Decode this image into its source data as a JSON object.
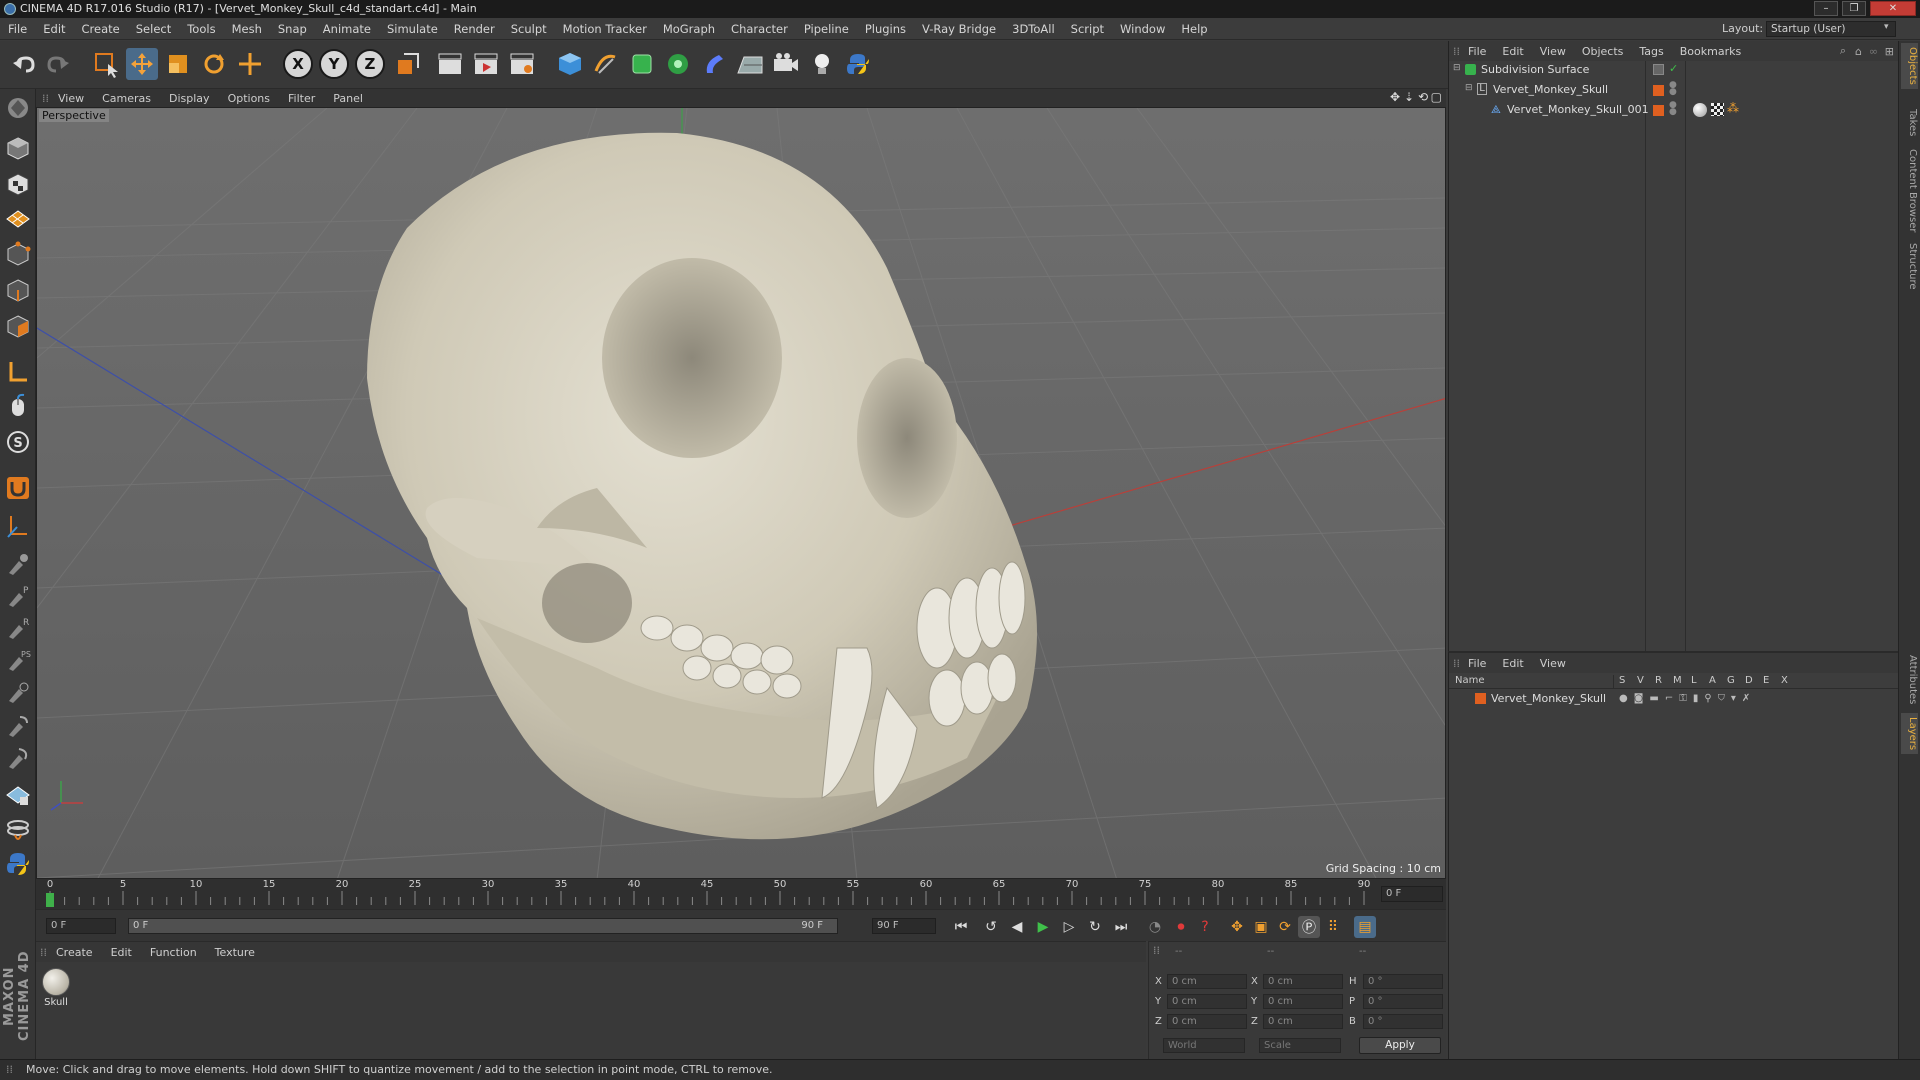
{
  "window": {
    "title": "CINEMA 4D R17.016 Studio (R17) - [Vervet_Monkey_Skull_c4d_standart.c4d] - Main",
    "controls": [
      "–",
      "❐",
      "✕"
    ]
  },
  "menubar": {
    "items": [
      "File",
      "Edit",
      "Create",
      "Select",
      "Tools",
      "Mesh",
      "Snap",
      "Animate",
      "Simulate",
      "Render",
      "Sculpt",
      "Motion Tracker",
      "MoGraph",
      "Character",
      "Pipeline",
      "Plugins",
      "V-Ray Bridge",
      "3DToAll",
      "Script",
      "Window",
      "Help"
    ],
    "layout_label": "Layout:",
    "layout_value": "Startup (User)"
  },
  "toolbar": {
    "axis_x": "X",
    "axis_y": "Y",
    "axis_z": "Z"
  },
  "viewport": {
    "menu": [
      "View",
      "Cameras",
      "Display",
      "Options",
      "Filter",
      "Panel"
    ],
    "label": "Perspective",
    "grid_spacing": "Grid Spacing : 10 cm"
  },
  "timeline": {
    "ticks": [
      "0",
      "5",
      "10",
      "15",
      "20",
      "25",
      "30",
      "35",
      "40",
      "45",
      "50",
      "55",
      "60",
      "65",
      "70",
      "75",
      "80",
      "85",
      "90"
    ],
    "current_frame": "0 F",
    "start_field": "0 F",
    "range_start": "0 F",
    "range_end": "90 F",
    "end_field": "90 F"
  },
  "material_manager": {
    "menu": [
      "Create",
      "Edit",
      "Function",
      "Texture"
    ],
    "materials": [
      {
        "name": "Skull"
      }
    ]
  },
  "coordinates": {
    "headers": [
      "--",
      "--",
      "--"
    ],
    "rows": [
      {
        "a": "X",
        "av": "0 cm",
        "b": "X",
        "bv": "0 cm",
        "c": "H",
        "cv": "0 °"
      },
      {
        "a": "Y",
        "av": "0 cm",
        "b": "Y",
        "bv": "0 cm",
        "c": "P",
        "cv": "0 °"
      },
      {
        "a": "Z",
        "av": "0 cm",
        "b": "Z",
        "bv": "0 cm",
        "c": "B",
        "cv": "0 °"
      }
    ],
    "space": "World",
    "mode": "Scale",
    "apply": "Apply"
  },
  "object_manager": {
    "menu": [
      "File",
      "Edit",
      "View",
      "Objects",
      "Tags",
      "Bookmarks"
    ],
    "objects": [
      {
        "name": "Subdivision Surface"
      },
      {
        "name": "Vervet_Monkey_Skull"
      },
      {
        "name": "Vervet_Monkey_Skull_001"
      }
    ]
  },
  "layer_manager": {
    "menu": [
      "File",
      "Edit",
      "View"
    ],
    "name_header": "Name",
    "columns": [
      "S",
      "V",
      "R",
      "M",
      "L",
      "A",
      "G",
      "D",
      "E",
      "X"
    ],
    "layers": [
      {
        "name": "Vervet_Monkey_Skull",
        "color": "#e06020"
      }
    ]
  },
  "side_tabs": [
    "Objects",
    "Takes",
    "Content Browser",
    "Structure",
    "Attributes",
    "Layers"
  ],
  "branding": "MAXON CINEMA 4D",
  "status": "Move: Click and drag to move elements. Hold down SHIFT to quantize movement / add to the selection in point mode, CTRL to remove.",
  "colors": {
    "accent": "#e07a1f",
    "layer_orange": "#e06020",
    "selected_blue": "#4a8ad0"
  }
}
